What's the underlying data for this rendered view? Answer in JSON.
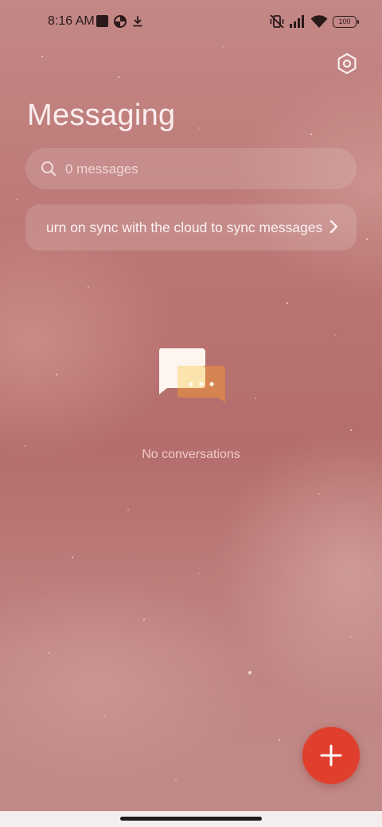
{
  "status_bar": {
    "time": "8:16 AM",
    "battery": "100",
    "icons": [
      "notification-square-icon",
      "data-saver-icon",
      "download-icon",
      "vibrate-off-icon",
      "signal-icon",
      "wifi-icon",
      "battery-icon"
    ]
  },
  "header": {
    "title": "Messaging",
    "settings_icon": "settings-hexagon-icon"
  },
  "search": {
    "placeholder": "0 messages",
    "icon": "search-icon"
  },
  "sync_banner": {
    "text": "Turn on sync with the cloud to sync messages",
    "icon": "chevron-right-icon"
  },
  "empty_state": {
    "icon": "chat-bubbles-icon",
    "text": "No conversations"
  },
  "fab": {
    "icon": "plus-icon"
  },
  "colors": {
    "accent": "#e03f2e",
    "background": "#b7706f",
    "text_light": "#fbeeee"
  }
}
